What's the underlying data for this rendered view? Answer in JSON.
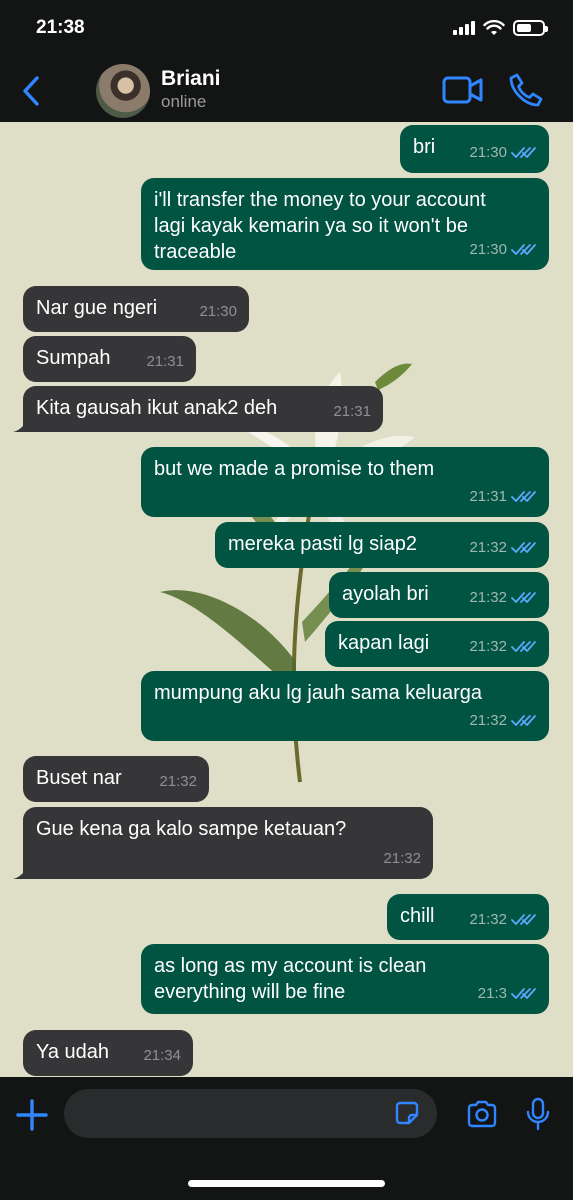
{
  "status_bar": {
    "time": "21:38",
    "battery_level": 0.6
  },
  "header": {
    "contact_name": "Briani",
    "contact_status": "online",
    "icons": [
      "chevron-left-icon",
      "video-camera-icon",
      "phone-icon"
    ]
  },
  "messages": [
    {
      "dir": "out",
      "text": "bri",
      "time": "21:30"
    },
    {
      "dir": "out",
      "lines": [
        "i'll transfer the money to your account",
        "lagi kayak kemarin ya so it won't be",
        "traceable"
      ],
      "time": "21:30"
    },
    {
      "dir": "in",
      "text": "Nar gue ngeri",
      "time": "21:30"
    },
    {
      "dir": "in",
      "text": "Sumpah",
      "time": "21:31"
    },
    {
      "dir": "in",
      "text": "Kita gausah ikut anak2 deh",
      "time": "21:31"
    },
    {
      "dir": "out",
      "text": "but we made a promise to them",
      "time": "21:31"
    },
    {
      "dir": "out",
      "text": "mereka pasti lg siap2",
      "time": "21:32"
    },
    {
      "dir": "out",
      "text": "ayolah bri",
      "time": "21:32"
    },
    {
      "dir": "out",
      "text": "kapan lagi",
      "time": "21:32"
    },
    {
      "dir": "out",
      "text": "mumpung aku lg jauh sama keluarga",
      "time": "21:32"
    },
    {
      "dir": "in",
      "text": "Buset nar",
      "time": "21:32"
    },
    {
      "dir": "in",
      "text": "Gue kena ga kalo sampe ketauan?",
      "time": "21:32"
    },
    {
      "dir": "out",
      "text": "chill",
      "time": "21:32"
    },
    {
      "dir": "out",
      "lines": [
        "as long as my account is clean",
        "everything will be fine"
      ],
      "time": "21:3"
    },
    {
      "dir": "in",
      "text": "Ya udah",
      "time": "21:34"
    }
  ],
  "input": {
    "placeholder": ""
  },
  "colors": {
    "outgoing": "#015342",
    "incoming": "#363638",
    "accent": "#2f86ff",
    "ticks": "#5aa9ff",
    "wallpaper": "#dfdfc7"
  }
}
